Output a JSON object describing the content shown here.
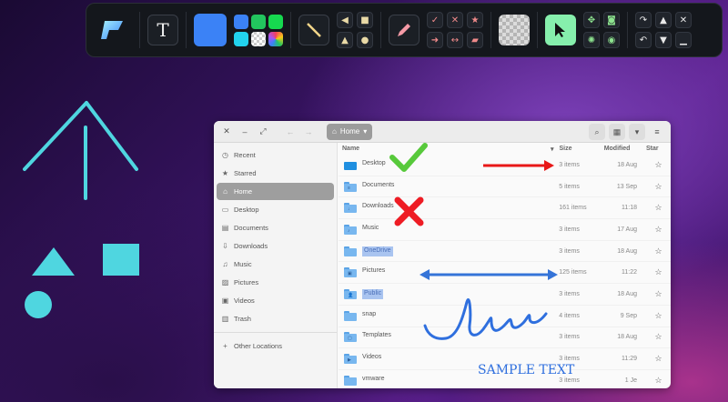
{
  "toolbar": {
    "text_tool": "T",
    "colors": {
      "main": "#3b82f6",
      "swatches": [
        "#3b82f6",
        "#22c55e",
        "#16d94f",
        "#22d3ee",
        "checker",
        "rainbow"
      ]
    },
    "accent": "#86efac"
  },
  "canvas": {
    "sample_text": "SAMPLE TEXT",
    "shape_color": "#4fd6e0",
    "check_color": "#57c93b",
    "cross_color": "#ee1c24",
    "arrow_red": "#e81818",
    "arrow_blue": "#3574d8",
    "scribble_color": "#2f6fde"
  },
  "window": {
    "path": "Home",
    "columns": {
      "name": "Name",
      "size": "Size",
      "modified": "Modified",
      "star": "Star"
    },
    "sidebar": [
      {
        "label": "Recent",
        "icon": "clock-icon",
        "glyph": "◷"
      },
      {
        "label": "Starred",
        "icon": "star-icon",
        "glyph": "★"
      },
      {
        "label": "Home",
        "icon": "home-icon",
        "glyph": "⌂",
        "active": true
      },
      {
        "label": "Desktop",
        "icon": "desktop-icon",
        "glyph": "▭"
      },
      {
        "label": "Documents",
        "icon": "document-icon",
        "glyph": "▤"
      },
      {
        "label": "Downloads",
        "icon": "download-icon",
        "glyph": "⇩"
      },
      {
        "label": "Music",
        "icon": "music-icon",
        "glyph": "♫"
      },
      {
        "label": "Pictures",
        "icon": "picture-icon",
        "glyph": "▨"
      },
      {
        "label": "Videos",
        "icon": "video-icon",
        "glyph": "▣"
      },
      {
        "label": "Trash",
        "icon": "trash-icon",
        "glyph": "▥"
      },
      {
        "label": "Other Locations",
        "icon": "plus-icon",
        "glyph": "+"
      }
    ],
    "files": [
      {
        "name": "Desktop",
        "size": "3 items",
        "modified": "18 Aug",
        "type": "desktop"
      },
      {
        "name": "Documents",
        "size": "5 items",
        "modified": "13 Sep",
        "type": "folder",
        "emblem": "≡"
      },
      {
        "name": "Downloads",
        "size": "161 items",
        "modified": "11:18",
        "type": "folder",
        "emblem": "↓"
      },
      {
        "name": "Music",
        "size": "3 items",
        "modified": "17 Aug",
        "type": "folder",
        "emblem": "♪"
      },
      {
        "name": "OneDrive",
        "size": "3 items",
        "modified": "18 Aug",
        "type": "folder",
        "highlight": true
      },
      {
        "name": "Pictures",
        "size": "125 items",
        "modified": "11:22",
        "type": "folder",
        "emblem": "▣"
      },
      {
        "name": "Public",
        "size": "3 items",
        "modified": "18 Aug",
        "type": "folder",
        "emblem": "👤",
        "highlight": true
      },
      {
        "name": "snap",
        "size": "4 items",
        "modified": "9 Sep",
        "type": "folder"
      },
      {
        "name": "Templates",
        "size": "3 items",
        "modified": "18 Aug",
        "type": "folder",
        "emblem": "▢"
      },
      {
        "name": "Videos",
        "size": "3 items",
        "modified": "11:29",
        "type": "folder",
        "emblem": "▶"
      },
      {
        "name": "vmware",
        "size": "3 items",
        "modified": "1 Je",
        "type": "folder"
      }
    ]
  }
}
